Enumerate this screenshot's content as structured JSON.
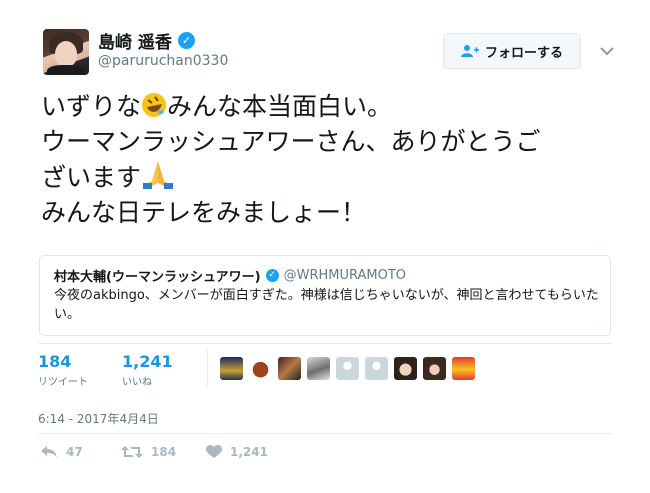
{
  "user": {
    "display_name": "島崎 遥香",
    "handle": "@paruruchan0330",
    "verified_icon": "verified-badge-icon"
  },
  "follow_button": {
    "label": "フォローする",
    "icon": "add-user-icon"
  },
  "menu_caret_icon": "chevron-down-icon",
  "tweet": {
    "line1a": "いずりな",
    "line1b": "みんな本当面白い。",
    "line2": "ウーマンラッシュアワーさん、ありがとうご",
    "line3": "ざいます",
    "line4": "みんな日テレをみましょー！",
    "emoji1": "rolling-on-floor-laughing-emoji",
    "emoji2": "folded-hands-emoji"
  },
  "quoted_tweet": {
    "display_name": "村本大輔(ウーマンラッシュアワー)",
    "handle": "@WRHMURAMOTO",
    "text": "今夜のakbingo、メンバーが面白すぎた。神様は信じちゃいないが、神回と言わせてもらいたい。"
  },
  "stats": {
    "retweets": {
      "count": "184",
      "label": "リツイート"
    },
    "likes": {
      "count": "1,241",
      "label": "いいね"
    }
  },
  "timestamp": "6:14 - 2017年4月4日",
  "actions": {
    "reply_count": "47",
    "retweet_count": "184",
    "like_count": "1,241"
  },
  "colors": {
    "accent": "#1da1f2",
    "link_blue": "#1b95e0",
    "muted": "#657786",
    "action_gray": "#aab8c2",
    "border": "#e1e8ed"
  }
}
